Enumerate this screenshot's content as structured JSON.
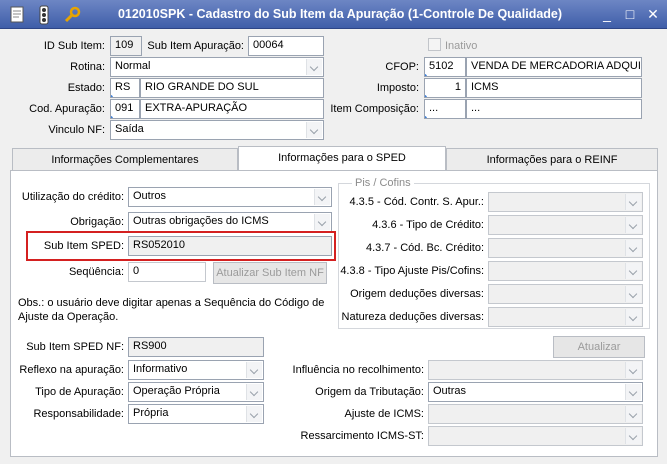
{
  "window": {
    "title": "012010SPK - Cadastro do Sub Item da Apuração (1-Controle De Qualidade)",
    "icons": [
      "doc-icon",
      "traffic-light-icon",
      "wrench-icon"
    ],
    "controls": {
      "minimize": "_",
      "maximize": "□",
      "close": "✕"
    }
  },
  "header": {
    "id_label": "ID Sub Item:",
    "id_value": "109",
    "sub_item_label": "Sub Item Apuração:",
    "sub_item_value": "00064",
    "inativo_label": "Inativo",
    "rotina_label": "Rotina:",
    "rotina_value": "Normal",
    "cfop_label": "CFOP:",
    "cfop_code": "5102",
    "cfop_desc": "VENDA DE MERCADORIA ADQUIRIDA",
    "estado_label": "Estado:",
    "estado_code": "RS",
    "estado_desc": "RIO GRANDE DO SUL",
    "imposto_label": "Imposto:",
    "imposto_code": "1",
    "imposto_desc": "ICMS",
    "cod_apur_label": "Cod. Apuração:",
    "cod_apur_code": "091",
    "cod_apur_desc": "EXTRA-APURAÇÃO",
    "item_comp_label": "Item Composição:",
    "item_comp_code": "...",
    "item_comp_desc": "...",
    "vinculo_label": "Vinculo NF:",
    "vinculo_value": "Saída"
  },
  "tabs": [
    {
      "label": "Informações Complementares"
    },
    {
      "label": "Informações para o SPED"
    },
    {
      "label": "Informações para o REINF"
    }
  ],
  "sped": {
    "utilizacao_label": "Utilização do crédito:",
    "utilizacao_value": "Outros",
    "obrigacao_label": "Obrigação:",
    "obrigacao_value": "Outras obrigações do ICMS",
    "sub_item_sped_label": "Sub Item SPED:",
    "sub_item_sped_value": "RS052010",
    "sequencia_label": "Seqüência:",
    "sequencia_value": "0",
    "atualizar_sub_item_label": "Atualizar Sub Item NF",
    "obs_text": "Obs.: o usuário deve digitar apenas a Sequência do Código de Ajuste da Operação.",
    "pis_cofins": {
      "title": "Pis / Cofins",
      "rows": [
        {
          "label": "4.3.5 - Cód. Contr. S. Apur.:"
        },
        {
          "label": "4.3.6 - Tipo de Crédito:"
        },
        {
          "label": "4.3.7 - Cód. Bc. Crédito:"
        },
        {
          "label": "4.3.8 - Tipo Ajuste Pis/Cofins:"
        },
        {
          "label": "Origem deduções diversas:"
        },
        {
          "label": "Natureza deduções diversas:"
        }
      ]
    },
    "atualizar_label": "Atualizar",
    "sub_item_sped_nf_label": "Sub Item SPED NF:",
    "sub_item_sped_nf_value": "RS900",
    "reflexo_label": "Reflexo na apuração:",
    "reflexo_value": "Informativo",
    "tipo_apur_label": "Tipo de Apuração:",
    "tipo_apur_value": "Operação Própria",
    "resp_label": "Responsabilidade:",
    "resp_value": "Própria",
    "influencia_label": "Influência no recolhimento:",
    "influencia_value": "",
    "origem_trib_label": "Origem da Tributação:",
    "origem_trib_value": "Outras",
    "ajuste_label": "Ajuste de ICMS:",
    "ajuste_value": "",
    "ressarc_label": "Ressarcimento ICMS-ST:",
    "ressarc_value": ""
  },
  "colors": {
    "title_bar": "#3f5ea9",
    "highlight_border": "#d42020",
    "link_dot": "#3b7dd8"
  }
}
